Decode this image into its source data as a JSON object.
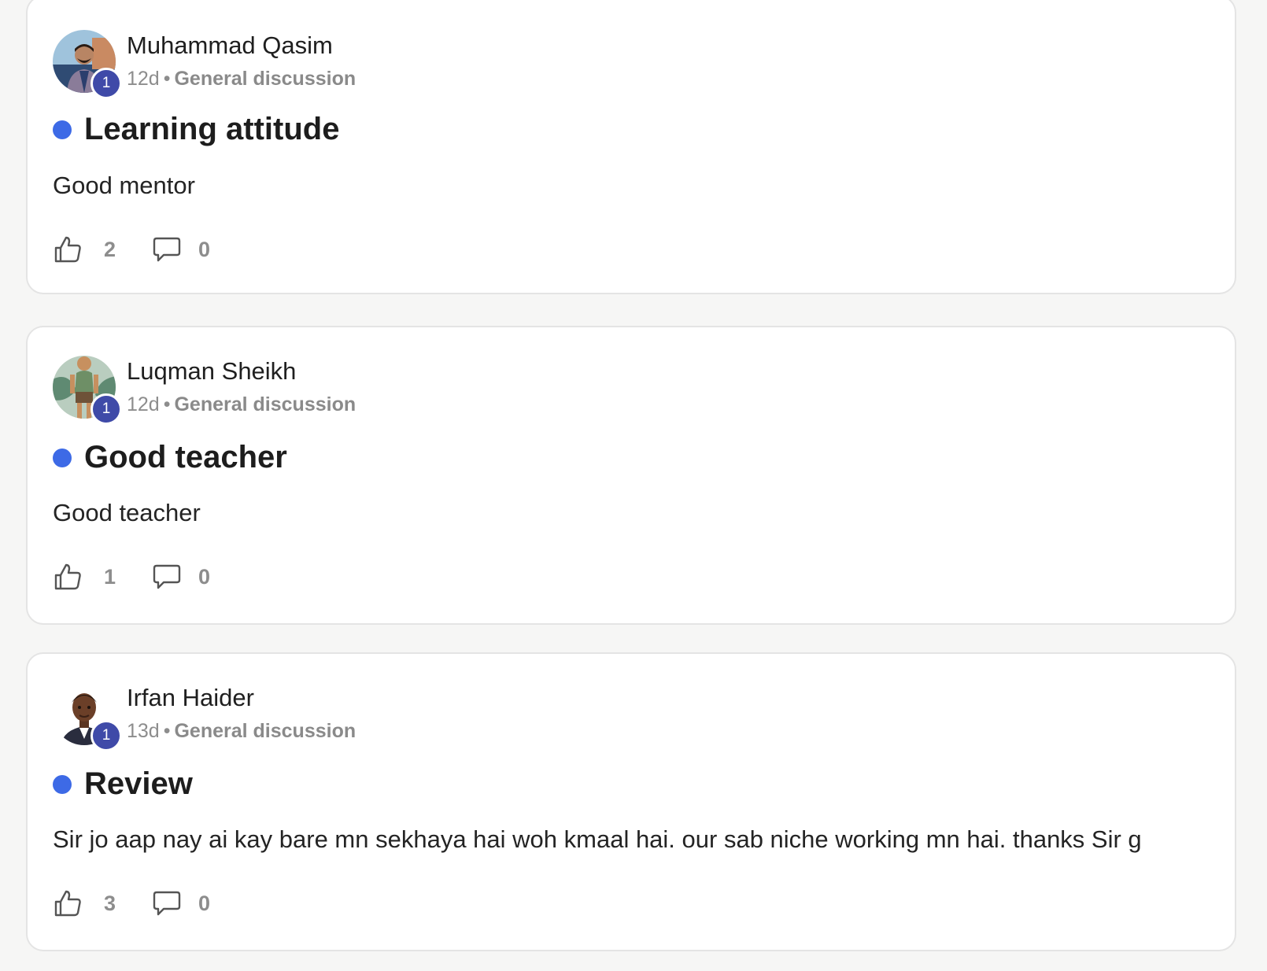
{
  "posts": [
    {
      "author": "Muhammad Qasim",
      "level": "1",
      "time": "12d",
      "separator": "•",
      "category": "General discussion",
      "title": "Learning attitude",
      "body": "Good mentor",
      "likes": "2",
      "comments": "0",
      "avatar_icon": "person-photo-avatar"
    },
    {
      "author": "Luqman Sheikh",
      "level": "1",
      "time": "12d",
      "separator": "•",
      "category": "General discussion",
      "title": "Good teacher",
      "body": "Good teacher",
      "likes": "1",
      "comments": "0",
      "avatar_icon": "cartoon-figure-avatar"
    },
    {
      "author": "Irfan Haider",
      "level": "1",
      "time": "13d",
      "separator": "•",
      "category": "General discussion",
      "title": "Review",
      "body": "Sir jo aap nay ai kay bare mn sekhaya hai woh kmaal hai. our sab niche working mn hai. thanks Sir g",
      "likes": "3",
      "comments": "0",
      "avatar_icon": "cartoon-man-avatar"
    }
  ],
  "colors": {
    "unread_dot": "#3d6ae6",
    "level_badge": "#3f4aa8",
    "muted_text": "#8d8d8d",
    "page_background": "#f6f6f5"
  }
}
